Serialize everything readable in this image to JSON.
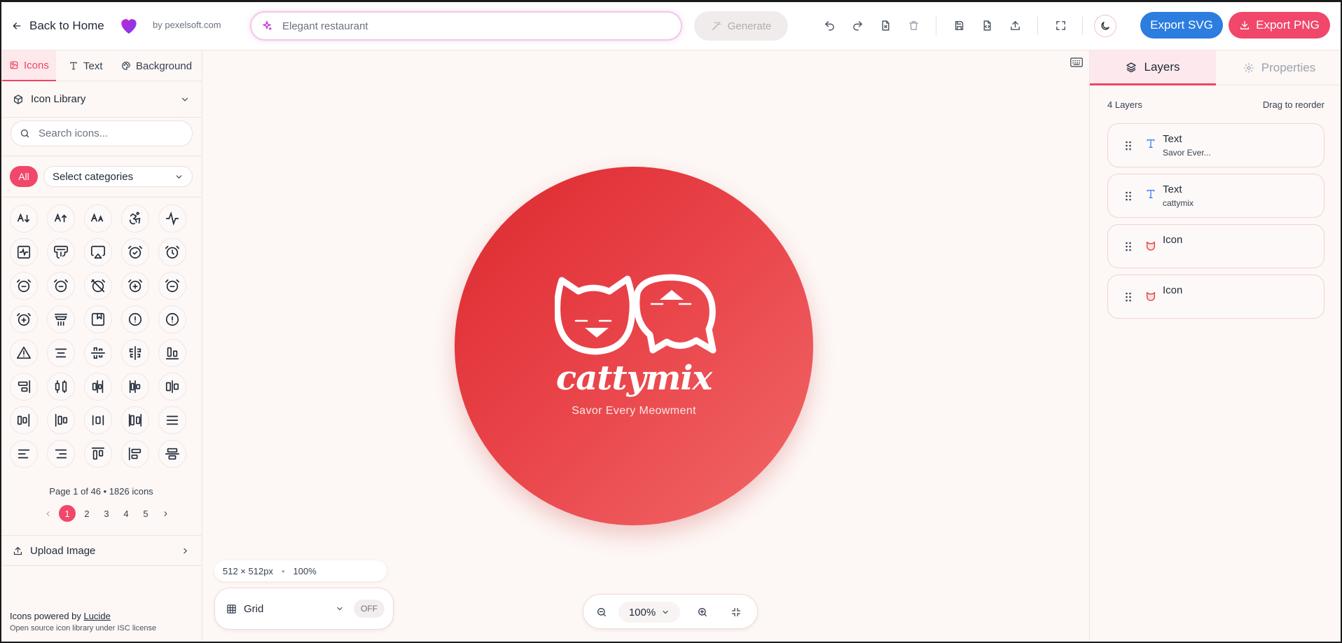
{
  "header": {
    "back_label": "Back to Home",
    "byline": "by pexelsoft.com",
    "prompt_value": "Elegant restaurant",
    "generate_label": "Generate",
    "export_svg_label": "Export SVG",
    "export_png_label": "Export PNG",
    "colors": {
      "accent": "#f0476a",
      "blue": "#2b7de0"
    }
  },
  "left_panel": {
    "tabs": [
      {
        "label": "Icons",
        "icon": "image-icon",
        "active": true
      },
      {
        "label": "Text",
        "icon": "type-icon",
        "active": false
      },
      {
        "label": "Background",
        "icon": "palette-icon",
        "active": false
      }
    ],
    "library_title": "Icon Library",
    "search_placeholder": "Search icons...",
    "all_label": "All",
    "category_placeholder": "Select categories",
    "pager_info": "Page 1 of 46 • 1826 icons",
    "pages": [
      "1",
      "2",
      "3",
      "4",
      "5"
    ],
    "upload_label": "Upload Image",
    "footer_prefix": "Icons powered by",
    "footer_link": "Lucide",
    "footer_license": "Open source icon library under ISC license"
  },
  "canvas": {
    "brand_text": "cattymix",
    "tagline": "Savor Every Meowment",
    "size_label": "512 × 512px",
    "zoom_small": "100%",
    "grid_label": "Grid",
    "grid_state": "OFF",
    "zoom_value": "100%",
    "gradient": [
      "#dc2a2f",
      "#f26868"
    ]
  },
  "right_panel": {
    "tabs": [
      {
        "label": "Layers",
        "active": true
      },
      {
        "label": "Properties",
        "active": false
      }
    ],
    "layers_count": "4 Layers",
    "drag_hint": "Drag to reorder",
    "layers": [
      {
        "name": "Text",
        "sub": "Savor Ever...",
        "type": "text"
      },
      {
        "name": "Text",
        "sub": "cattymix",
        "type": "text"
      },
      {
        "name": "Icon",
        "sub": "",
        "type": "icon"
      },
      {
        "name": "Icon",
        "sub": "",
        "type": "icon"
      }
    ]
  }
}
